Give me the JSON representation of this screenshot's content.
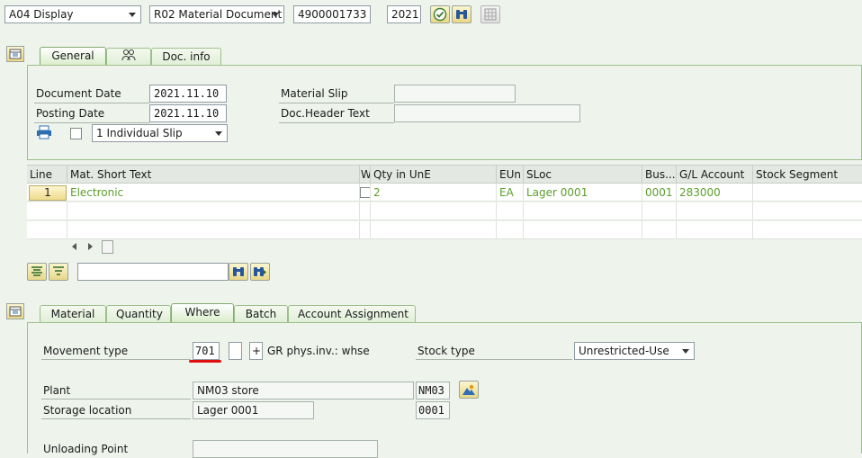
{
  "header": {
    "action_select": "A04 Display",
    "doc_type_select": "R02 Material Document",
    "doc_number": "4900001733",
    "doc_year": "2021"
  },
  "general_tabs": [
    {
      "label": "General"
    },
    {
      "label": ""
    },
    {
      "label": "Doc. info"
    }
  ],
  "general": {
    "document_date_label": "Document Date",
    "document_date": "2021.11.10",
    "posting_date_label": "Posting Date",
    "posting_date": "2021.11.10",
    "material_slip_label": "Material Slip",
    "material_slip": "",
    "doc_header_text_label": "Doc.Header Text",
    "doc_header_text": "",
    "print_slip_select": "1 Individual Slip"
  },
  "items_table": {
    "columns": [
      "Line",
      "Mat. Short Text",
      "W",
      "Qty in UnE",
      "EUn",
      "SLoc",
      "Bus...",
      "G/L Account",
      "Stock Segment"
    ],
    "rows": [
      {
        "line": "1",
        "mat_short_text": "Electronic",
        "w": "",
        "qty": "2",
        "eun": "EA",
        "sloc": "Lager 0001",
        "bus": "0001",
        "gl_account": "283000",
        "stock_segment": ""
      }
    ]
  },
  "detail_tabs": [
    {
      "label": "Material"
    },
    {
      "label": "Quantity"
    },
    {
      "label": "Where"
    },
    {
      "label": "Batch"
    },
    {
      "label": "Account Assignment"
    }
  ],
  "where": {
    "movement_type_label": "Movement type",
    "movement_type": "701",
    "movement_sign": "+",
    "movement_desc": "GR phys.inv.: whse",
    "stock_type_label": "Stock type",
    "stock_type": "Unrestricted-Use",
    "plant_label": "Plant",
    "plant_name": "NM03 store",
    "plant_code": "NM03",
    "storage_location_label": "Storage location",
    "storage_location_name": "Lager 0001",
    "storage_location_code": "0001",
    "unloading_point_label": "Unloading Point",
    "unloading_point": ""
  },
  "colors": {
    "accent_green": "#5ca02a",
    "highlight_red": "#e01010",
    "panel_bg": "#eef4ec"
  }
}
